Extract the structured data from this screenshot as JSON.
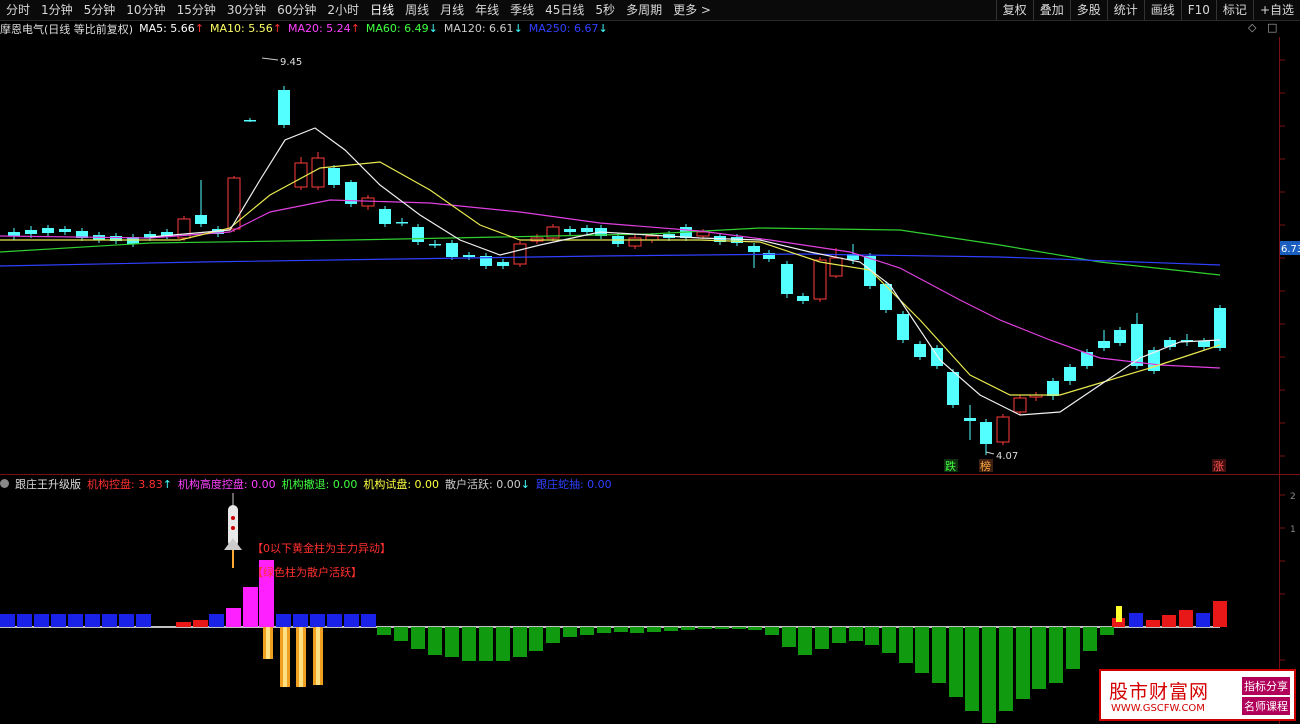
{
  "toolbar": {
    "periods": [
      "分时",
      "1分钟",
      "5分钟",
      "10分钟",
      "15分钟",
      "30分钟",
      "60分钟",
      "2小时",
      "日线",
      "周线",
      "月线",
      "年线",
      "季线",
      "45日线",
      "5秒",
      "多周期",
      "更多 >"
    ],
    "active_index": 8,
    "right_tools": [
      "复权",
      "叠加",
      "多股",
      "统计",
      "画线",
      "F10",
      "标记",
      "+自选"
    ]
  },
  "main_chart": {
    "title": "摩恩电气(日线 等比前复权)",
    "ma": [
      {
        "label": "MA5: 5.66",
        "arrow": "↑",
        "color": "#ffffff",
        "arrow_color": "#ff3030"
      },
      {
        "label": "MA10: 5.56",
        "arrow": "↑",
        "color": "#ffff66",
        "arrow_color": "#ff3030"
      },
      {
        "label": "MA20: 5.24",
        "arrow": "↑",
        "color": "#ff40ff",
        "arrow_color": "#ff3030"
      },
      {
        "label": "MA60: 6.49",
        "arrow": "↓",
        "color": "#40ff40",
        "arrow_color": "#40ffff"
      },
      {
        "label": "MA120: 6.61",
        "arrow": "↓",
        "color": "#cccccc",
        "arrow_color": "#40ffff"
      },
      {
        "label": "MA250: 6.67",
        "arrow": "↓",
        "color": "#3040ff",
        "arrow_color": "#40ffff"
      }
    ],
    "high_label": "9.45",
    "low_label": "4.07",
    "price_tag": "6.73",
    "marker_die": "跌",
    "marker_bang": "榜",
    "marker_zhang": "涨"
  },
  "indicator": {
    "title": "跟庄王升级版",
    "items": [
      {
        "label": "机构控盘: 3.83",
        "arrow": "↑",
        "color": "#ff3030"
      },
      {
        "label": "机构高度控盘: 0.00",
        "arrow": "",
        "color": "#ff40ff"
      },
      {
        "label": "机构撤退: 0.00",
        "arrow": "",
        "color": "#40ff40"
      },
      {
        "label": "机构试盘: 0.00",
        "arrow": "",
        "color": "#ffff40"
      },
      {
        "label": "散户活跃: 0.00",
        "arrow": "↓",
        "color": "#cccccc"
      },
      {
        "label": "跟庄蛇抽: 0.00",
        "arrow": "",
        "color": "#3040ff"
      }
    ],
    "note1": "【0以下黄金柱为主力异动】",
    "note2": "【绿色柱为散户活跃】",
    "axis_ticks": [
      "2",
      "1"
    ]
  },
  "watermark": {
    "cn": "股市财富网",
    "url": "WWW.GSCFW.COM",
    "tag1": "指标分享",
    "tag2": "名师课程"
  },
  "colors": {
    "up": "#ff3c3c",
    "down": "#54ffff",
    "bg": "#000000"
  }
}
